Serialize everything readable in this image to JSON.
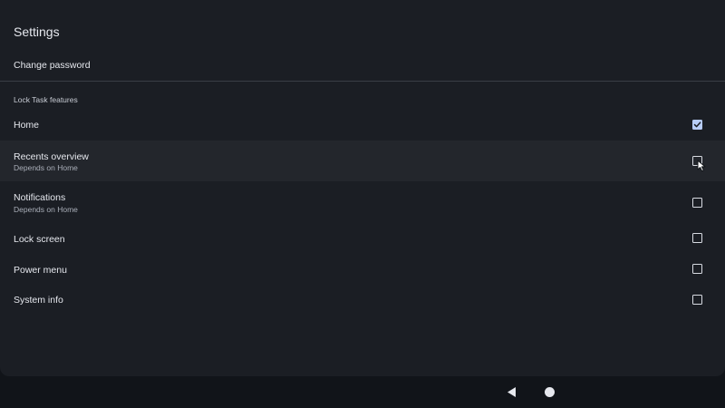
{
  "header": {
    "title": "Settings"
  },
  "account": {
    "change_password_label": "Change password"
  },
  "lock_task": {
    "section_title": "Lock Task features",
    "items": [
      {
        "label": "Home",
        "subtitle": "",
        "checked": true
      },
      {
        "label": "Recents overview",
        "subtitle": "Depends on Home",
        "checked": false
      },
      {
        "label": "Notifications",
        "subtitle": "Depends on Home",
        "checked": false
      },
      {
        "label": "Lock screen",
        "subtitle": "",
        "checked": false
      },
      {
        "label": "Power menu",
        "subtitle": "",
        "checked": false
      },
      {
        "label": "System info",
        "subtitle": "",
        "checked": false
      }
    ]
  },
  "navigation": {
    "back_icon": "back-triangle-icon",
    "home_icon": "home-circle-icon"
  },
  "colors": {
    "background": "#1b1e24",
    "accent_checked": "#b8cdf7",
    "highlight_row": "#23262c"
  }
}
